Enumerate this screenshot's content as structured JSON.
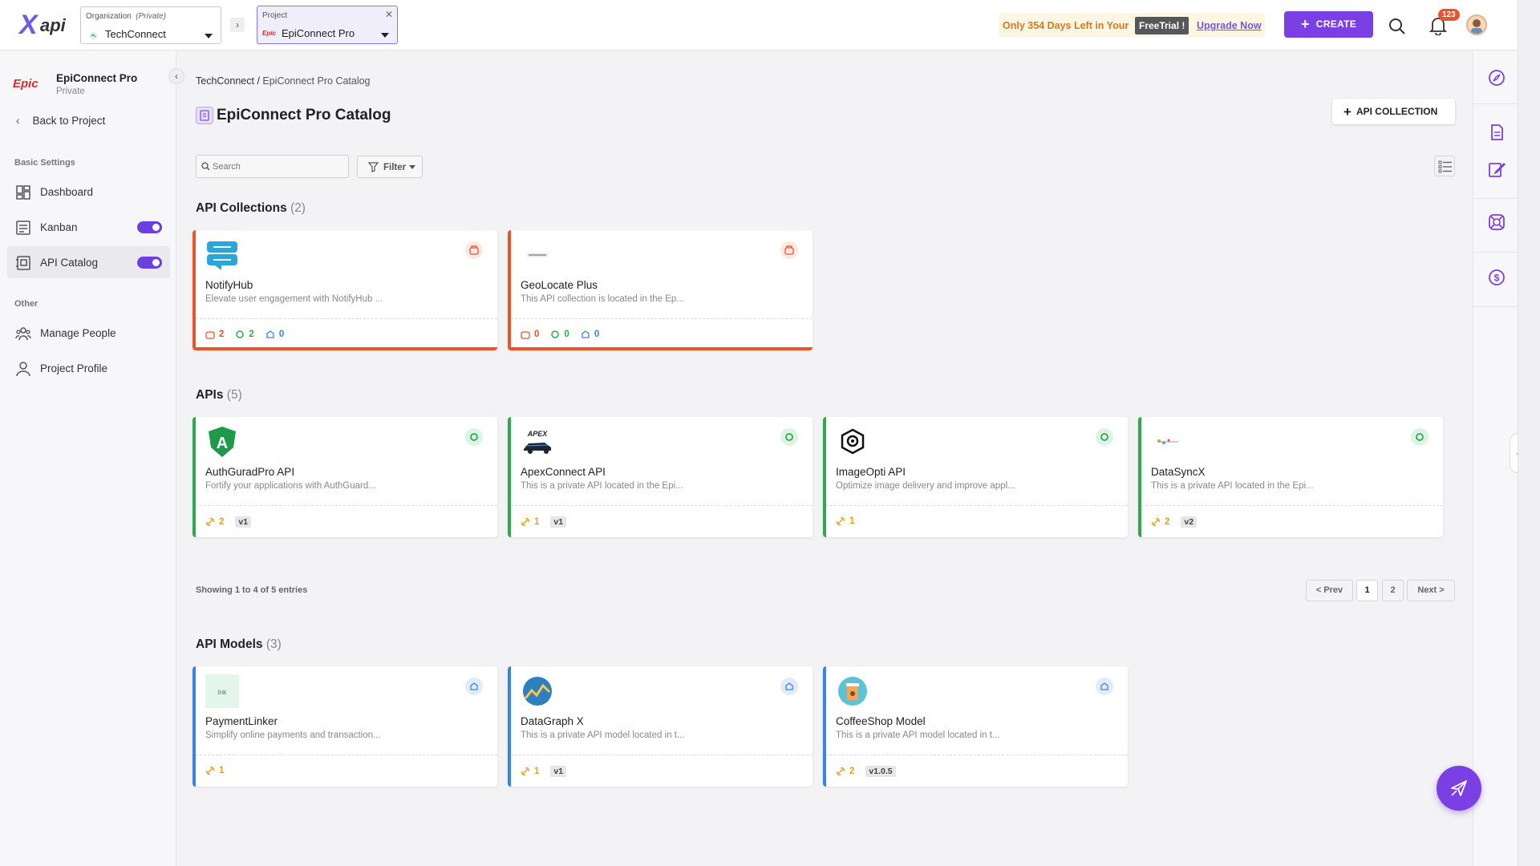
{
  "brand": {
    "logo_text": "api"
  },
  "header": {
    "org_label": "Organization",
    "org_visibility": "(Private)",
    "org_value": "TechConnect",
    "project_label": "Project",
    "project_value": "EpiConnect Pro",
    "trial_text": "Only 354 Days Left in Your",
    "trial_badge": "FreeTrial !",
    "trial_link": "Upgrade Now",
    "create_label": "CREATE",
    "notifications_count": "123"
  },
  "sidebar": {
    "project_logo": "Epic",
    "project_name": "EpiConnect Pro",
    "project_visibility": "Private",
    "back_label": "Back to Project",
    "basic_settings_title": "Basic Settings",
    "other_title": "Other",
    "items": [
      {
        "label": "Dashboard",
        "icon": "dashboard-icon"
      },
      {
        "label": "Kanban",
        "icon": "kanban-icon",
        "toggle": true
      },
      {
        "label": "API Catalog",
        "icon": "catalog-icon",
        "toggle": true,
        "active": true
      },
      {
        "label": "Manage People",
        "icon": "people-icon"
      },
      {
        "label": "Project Profile",
        "icon": "profile-icon"
      }
    ]
  },
  "main": {
    "breadcrumb_root": "TechConnect",
    "breadcrumb_sep": " / ",
    "breadcrumb_current": "EpiConnect Pro Catalog",
    "title": "EpiConnect Pro Catalog",
    "add_collection_label": "API COLLECTION",
    "search_placeholder": "Search",
    "filter_label": "Filter",
    "collections": {
      "title": "API Collections",
      "count": "(2)",
      "items": [
        {
          "name": "NotifyHub",
          "desc": "Elevate user engagement with NotifyHub ...",
          "s1": "2",
          "s2": "2",
          "s3": "0"
        },
        {
          "name": "GeoLocate Plus",
          "desc": "This API collection is located in the Ep...",
          "s1": "0",
          "s2": "0",
          "s3": "0"
        }
      ]
    },
    "apis": {
      "title": "APIs",
      "count": "(5)",
      "items": [
        {
          "name": "AuthGuradPro API",
          "desc": "Fortify your applications with AuthGuard...",
          "count": "2",
          "version": "v1"
        },
        {
          "name": "ApexConnect API",
          "desc": "This is a private API located in the Epi...",
          "count": "1",
          "version": "v1"
        },
        {
          "name": "ImageOpti API",
          "desc": "Optimize image delivery and improve appl...",
          "count": "1",
          "version": ""
        },
        {
          "name": "DataSyncX",
          "desc": "This is a private API located in the Epi...",
          "count": "2",
          "version": "v2"
        }
      ],
      "showing": "Showing 1 to 4 of 5 entries",
      "pagination": {
        "prev": "< Prev",
        "p1": "1",
        "p2": "2",
        "next": "Next >"
      }
    },
    "models": {
      "title": "API Models",
      "count": "(3)",
      "items": [
        {
          "name": "PaymentLinker",
          "desc": "Simplify online payments and transaction...",
          "count": "1",
          "version": ""
        },
        {
          "name": "DataGraph X",
          "desc": "This is a private API model located in t...",
          "count": "1",
          "version": "v1"
        },
        {
          "name": "CoffeeShop Model",
          "desc": "This is a private API model located in t...",
          "count": "2",
          "version": "v1.0.5"
        }
      ]
    }
  },
  "colors": {
    "accent": "#7b3fe4",
    "collection": "#e8542e",
    "api": "#2fa84f",
    "model": "#3b82e6"
  }
}
